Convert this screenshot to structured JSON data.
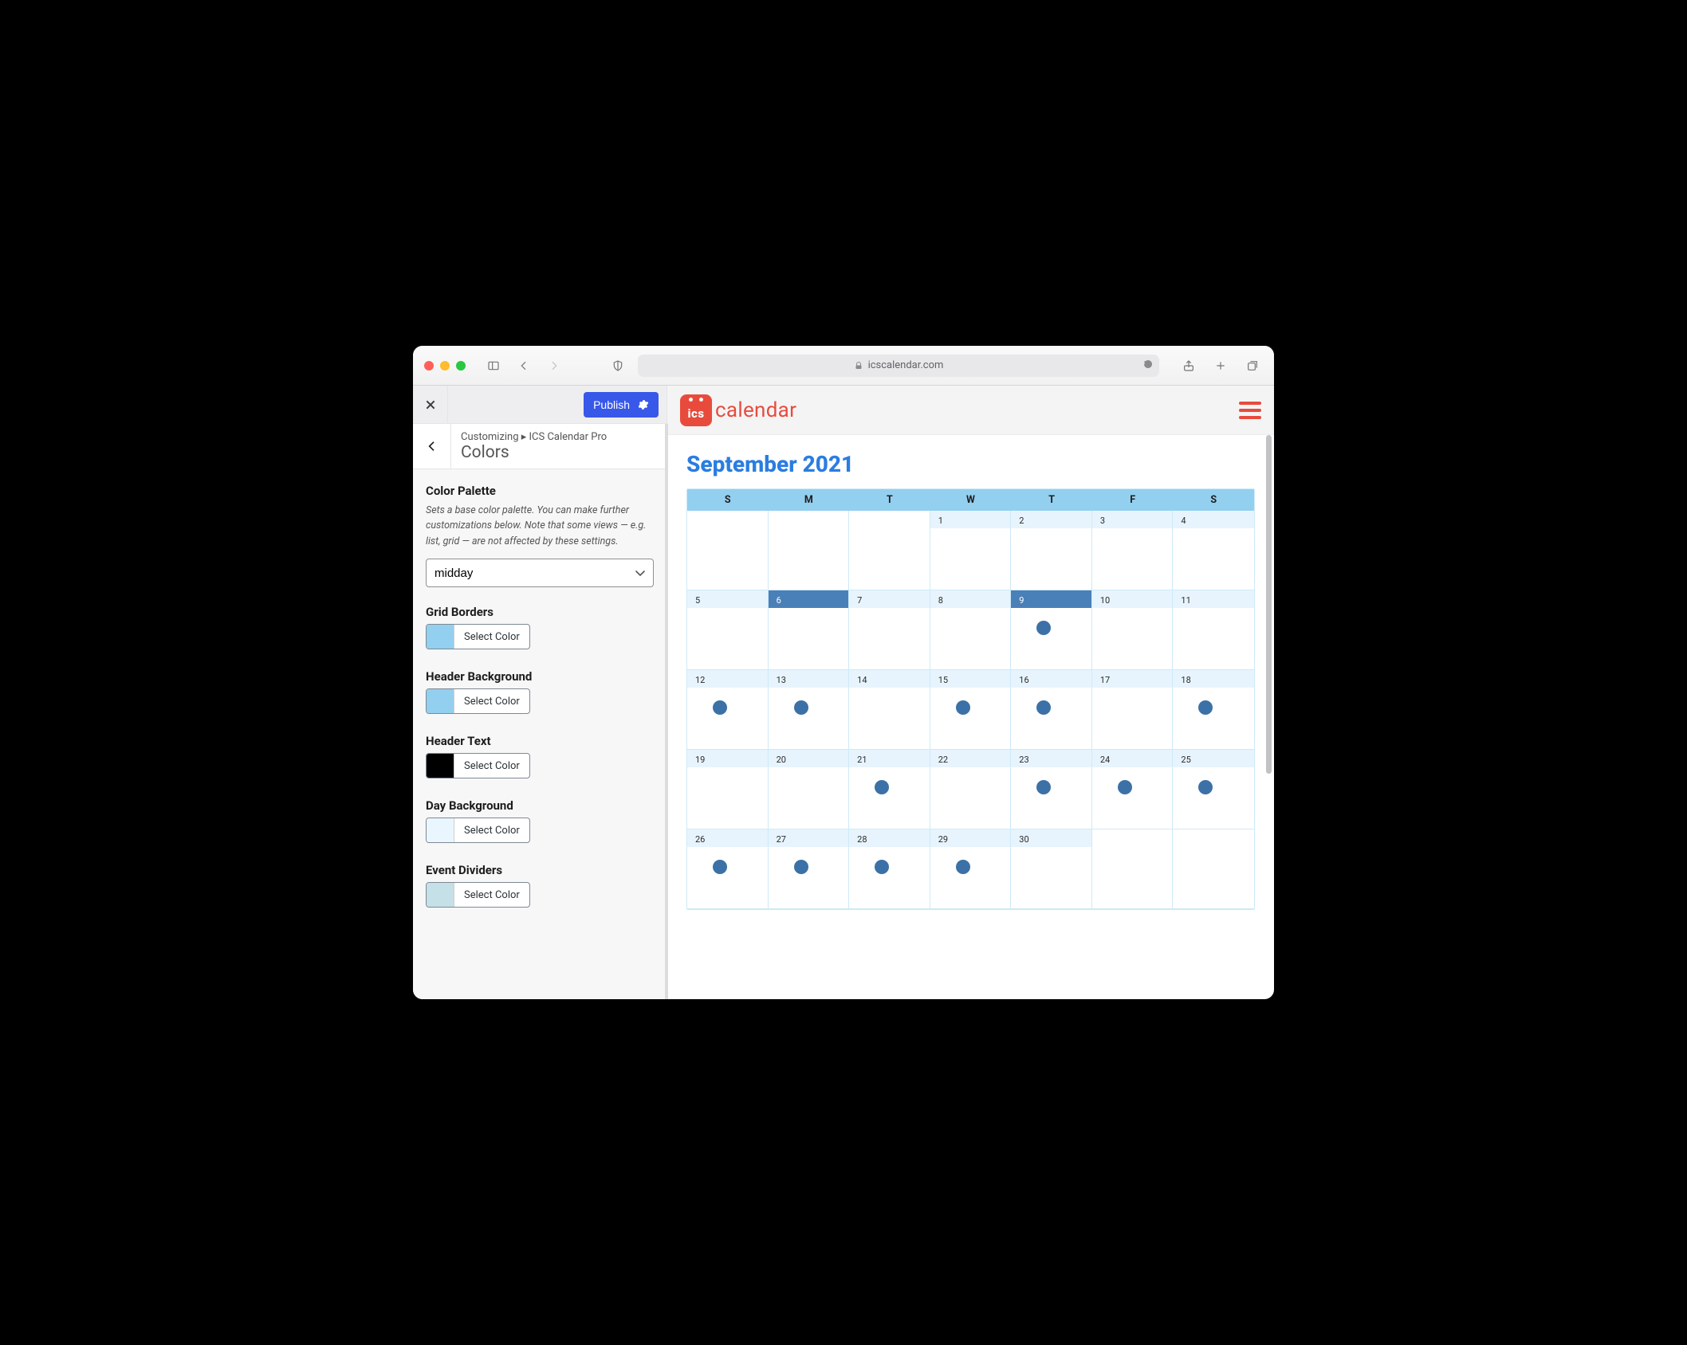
{
  "browser": {
    "url_host": "icscalendar.com"
  },
  "customizer": {
    "publish_label": "Publish",
    "breadcrumb_prefix": "Customizing",
    "breadcrumb_section": "ICS Calendar Pro",
    "page_title": "Colors",
    "palette": {
      "label": "Color Palette",
      "description": "Sets a base color palette. You can make further customizations below. Note that some views — e.g. list, grid — are not affected by these settings.",
      "selected": "midday"
    },
    "select_color_label": "Select Color",
    "colors": [
      {
        "key": "grid_borders",
        "label": "Grid Borders",
        "swatch": "#93cfef"
      },
      {
        "key": "header_background",
        "label": "Header Background",
        "swatch": "#93cfef"
      },
      {
        "key": "header_text",
        "label": "Header Text",
        "swatch": "#000000"
      },
      {
        "key": "day_background",
        "label": "Day Background",
        "swatch": "#eaf6fe"
      },
      {
        "key": "event_dividers",
        "label": "Event Dividers",
        "swatch": "#c5e0e6"
      }
    ]
  },
  "site": {
    "logo_badge_text": "ics",
    "logo_word": "calendar"
  },
  "calendar": {
    "title": "September 2021",
    "day_labels": [
      "S",
      "M",
      "T",
      "W",
      "T",
      "F",
      "S"
    ],
    "weeks": [
      [
        {
          "n": "",
          "empty": true
        },
        {
          "n": "",
          "empty": true
        },
        {
          "n": "",
          "empty": true
        },
        {
          "n": "1"
        },
        {
          "n": "2"
        },
        {
          "n": "3"
        },
        {
          "n": "4"
        }
      ],
      [
        {
          "n": "5"
        },
        {
          "n": "6",
          "highlight": true
        },
        {
          "n": "7"
        },
        {
          "n": "8"
        },
        {
          "n": "9",
          "highlight": true,
          "event": true
        },
        {
          "n": "10"
        },
        {
          "n": "11"
        }
      ],
      [
        {
          "n": "12",
          "event": true
        },
        {
          "n": "13",
          "event": true
        },
        {
          "n": "14"
        },
        {
          "n": "15",
          "event": true
        },
        {
          "n": "16",
          "event": true
        },
        {
          "n": "17"
        },
        {
          "n": "18",
          "event": true
        }
      ],
      [
        {
          "n": "19"
        },
        {
          "n": "20"
        },
        {
          "n": "21",
          "event": true
        },
        {
          "n": "22"
        },
        {
          "n": "23",
          "event": true
        },
        {
          "n": "24",
          "event": true
        },
        {
          "n": "25",
          "event": true
        }
      ],
      [
        {
          "n": "26",
          "event": true
        },
        {
          "n": "27",
          "event": true
        },
        {
          "n": "28",
          "event": true
        },
        {
          "n": "29",
          "event": true
        },
        {
          "n": "30"
        },
        {
          "n": "",
          "empty": true
        },
        {
          "n": "",
          "empty": true
        }
      ]
    ]
  }
}
